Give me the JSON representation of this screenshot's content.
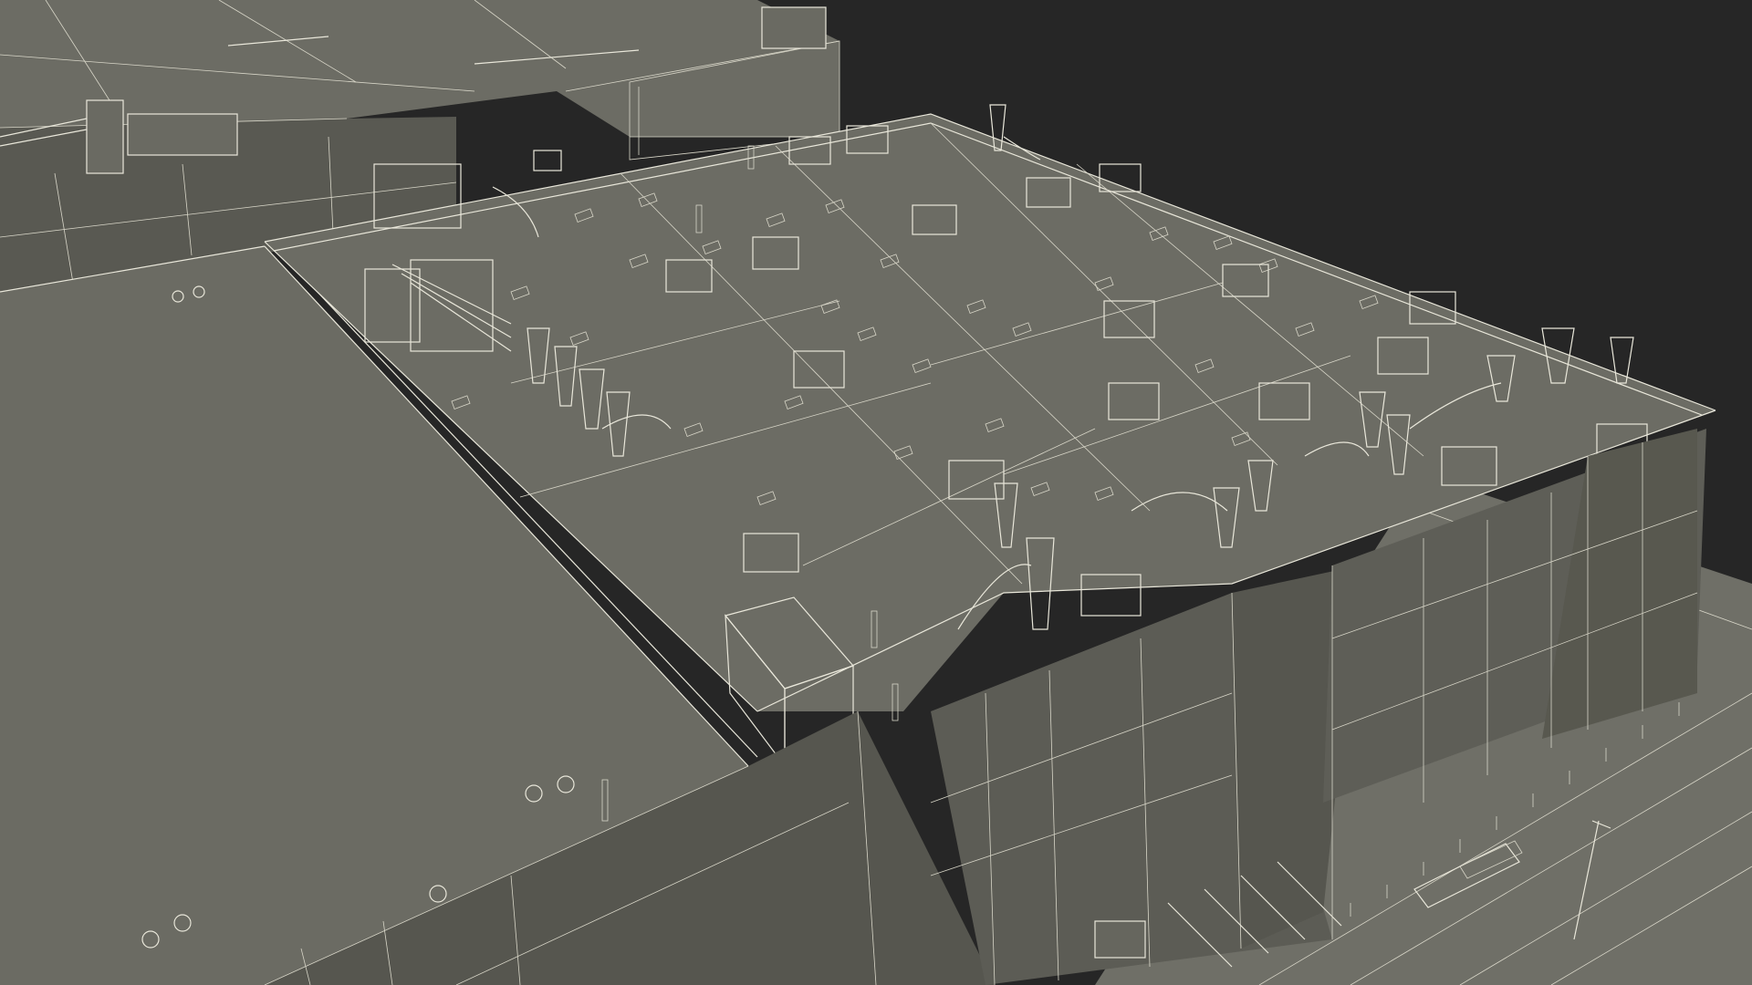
{
  "scene": {
    "subject": "",
    "colors": {
      "background": "#262626",
      "roof": "#6c6c64",
      "roof_dark": "#5f5f58",
      "wall": "#5a5a53",
      "wall_dark": "#4d4d47",
      "ground": "#6f6f67",
      "wire": "#e9e7da"
    }
  }
}
